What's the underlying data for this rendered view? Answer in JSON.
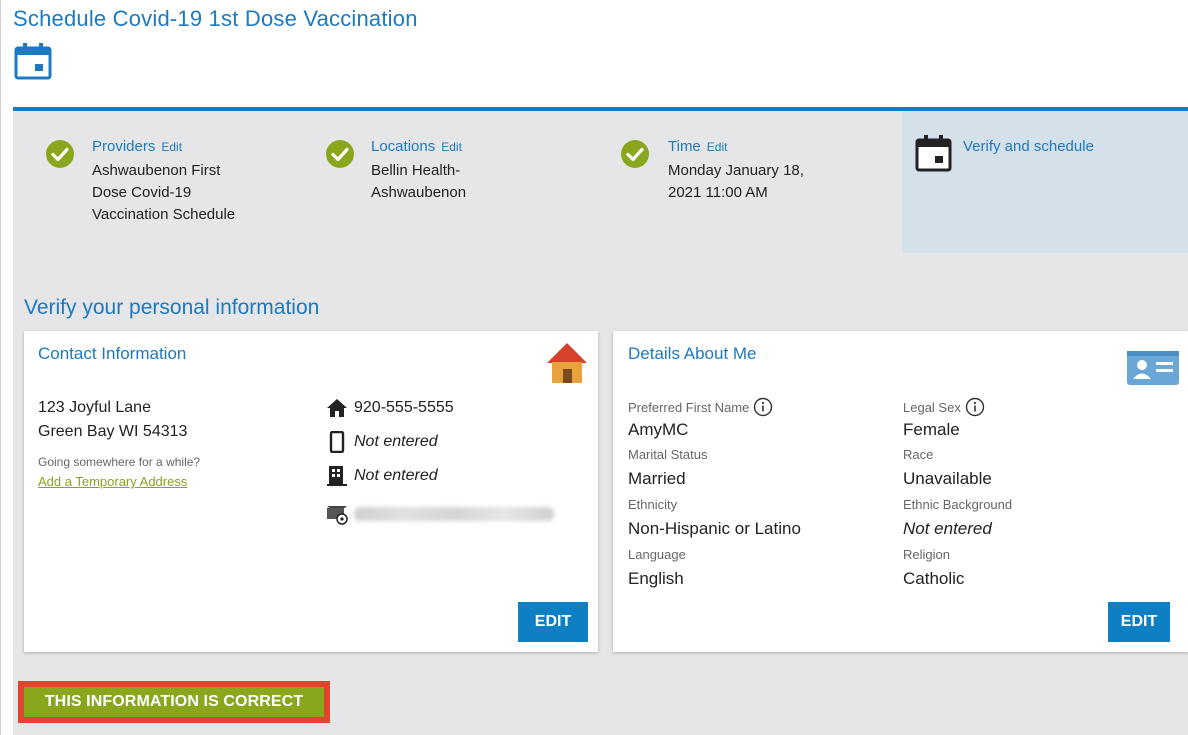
{
  "page": {
    "title": "Schedule Covid-19 1st Dose Vaccination"
  },
  "steps": [
    {
      "label": "Providers",
      "edit": "Edit",
      "value": [
        "Ashwaubenon First",
        "Dose Covid-19",
        "Vaccination Schedule"
      ],
      "status": "complete"
    },
    {
      "label": "Locations",
      "edit": "Edit",
      "value": [
        "Bellin Health-",
        "Ashwaubenon"
      ],
      "status": "complete"
    },
    {
      "label": "Time",
      "edit": "Edit",
      "value": [
        "Monday January 18,",
        "2021 11:00 AM"
      ],
      "status": "complete"
    },
    {
      "label": "Verify and schedule",
      "status": "active"
    }
  ],
  "verify": {
    "title": "Verify your personal information"
  },
  "contact": {
    "title": "Contact Information",
    "address_line1": "123 Joyful Lane",
    "address_line2": "Green Bay WI 54313",
    "away_prompt": "Going somewhere for a while?",
    "temp_address_link": "Add a Temporary Address",
    "home_phone": "920-555-5555",
    "mobile_phone": "Not entered",
    "work_phone": "Not entered",
    "edit_label": "EDIT"
  },
  "details": {
    "title": "Details About Me",
    "preferred_first_name_label": "Preferred First Name",
    "preferred_first_name": "AmyMC",
    "legal_sex_label": "Legal Sex",
    "legal_sex": "Female",
    "marital_status_label": "Marital Status",
    "marital_status": "Married",
    "race_label": "Race",
    "race": "Unavailable",
    "ethnicity_label": "Ethnicity",
    "ethnicity": "Non-Hispanic or Latino",
    "ethnic_background_label": "Ethnic Background",
    "ethnic_background": "Not entered",
    "language_label": "Language",
    "language": "English",
    "religion_label": "Religion",
    "religion": "Catholic",
    "edit_label": "EDIT"
  },
  "confirm": {
    "label": "THIS INFORMATION IS CORRECT"
  },
  "colors": {
    "primary_blue": "#1b7ac0",
    "button_blue": "#0f7fc3",
    "check_green": "#89a71c",
    "confirm_green": "#89a71c",
    "highlight_red": "#e0452f",
    "active_step_bg": "#d4e0ea",
    "panel_gray": "#e6e6e8"
  },
  "icons": {
    "title": "calendar-icon",
    "step_complete": "checkmark-circle-icon",
    "step_active": "calendar-icon",
    "contact_card": "house-icon",
    "details_card": "id-card-icon",
    "home_phone": "home-icon",
    "mobile_phone": "mobile-phone-icon",
    "work_phone": "office-building-icon",
    "email": "email-icon",
    "field_info": "info-circle-icon"
  }
}
